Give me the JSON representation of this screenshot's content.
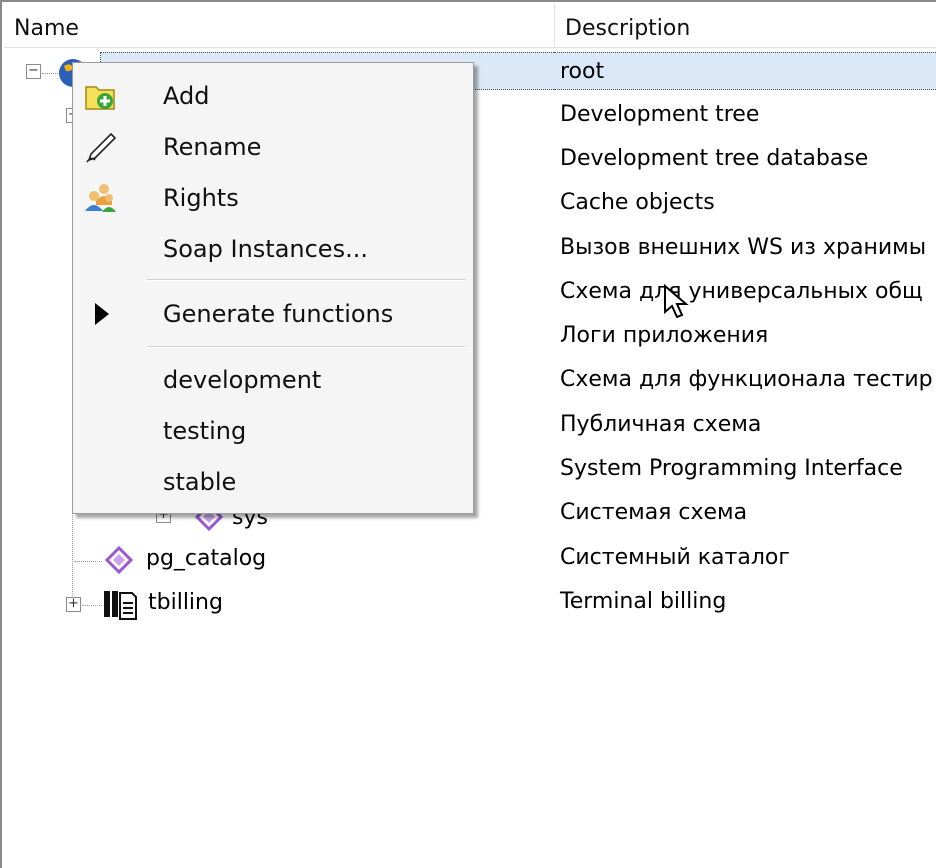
{
  "columns": {
    "name": "Name",
    "description": "Description"
  },
  "rows": [
    {
      "name": "",
      "description": "root"
    },
    {
      "name": "",
      "description": "Development tree"
    },
    {
      "name": "",
      "description": "Development tree database"
    },
    {
      "name": "",
      "description": "Cache objects"
    },
    {
      "name": "",
      "description": "Вызов внешних WS из хранимы"
    },
    {
      "name": "",
      "description": "Схема для универсальных общ"
    },
    {
      "name": "",
      "description": "Логи приложения"
    },
    {
      "name": "",
      "description": "Схема для функционала тестир"
    },
    {
      "name": "",
      "description": "Публичная схема"
    },
    {
      "name": "",
      "description": "System Programming Interface"
    },
    {
      "name": "sys",
      "description": "Системая схема"
    },
    {
      "name": "pg_catalog",
      "description": "Системный каталог"
    },
    {
      "name": "tbilling",
      "description": "Terminal billing"
    }
  ],
  "context_menu": {
    "items": [
      {
        "label": "Add",
        "icon": "folder-add-icon"
      },
      {
        "label": "Rename",
        "icon": "pen-icon"
      },
      {
        "label": "Rights",
        "icon": "users-icon"
      },
      {
        "label": "Soap Instances...",
        "icon": ""
      },
      {
        "label": "Generate functions",
        "icon": "submenu-arrow-icon"
      },
      {
        "label": "development",
        "icon": ""
      },
      {
        "label": "testing",
        "icon": ""
      },
      {
        "label": "stable",
        "icon": ""
      }
    ]
  },
  "colors": {
    "selection": "#dbe8f8",
    "schema_icon": "#9b59d0",
    "menu_background": "#f5f5f5"
  }
}
